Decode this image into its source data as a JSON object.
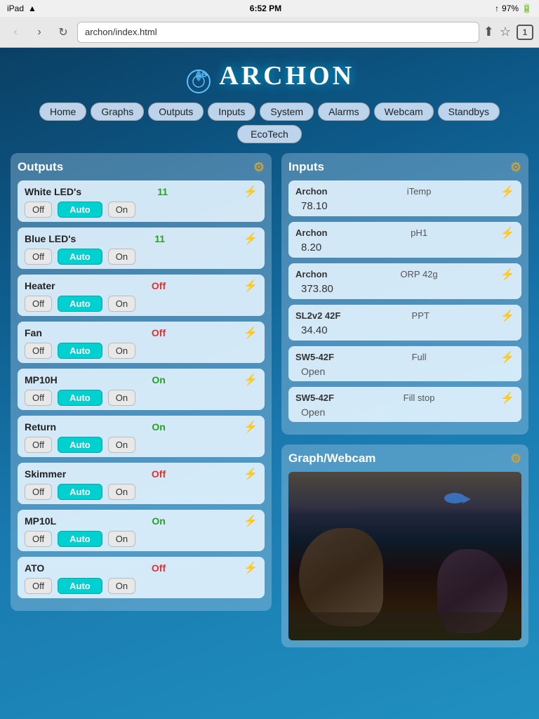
{
  "statusBar": {
    "carrier": "iPad",
    "wifi": "WiFi",
    "time": "6:52 PM",
    "battery": "97%"
  },
  "browser": {
    "url": "archon/index.html",
    "tabCount": "1"
  },
  "logo": {
    "text": "ARCHON"
  },
  "nav": {
    "items": [
      "Home",
      "Graphs",
      "Outputs",
      "Inputs",
      "System",
      "Alarms",
      "Webcam",
      "Standbys"
    ],
    "secondary": [
      "EcoTech"
    ]
  },
  "outputs": {
    "title": "Outputs",
    "devices": [
      {
        "name": "White LED's",
        "status": "11",
        "statusType": "num",
        "off": "Off",
        "auto": "Auto",
        "on": "On"
      },
      {
        "name": "Blue LED's",
        "status": "11",
        "statusType": "num",
        "off": "Off",
        "auto": "Auto",
        "on": "On"
      },
      {
        "name": "Heater",
        "status": "Off",
        "statusType": "off",
        "off": "Off",
        "auto": "Auto",
        "on": "On"
      },
      {
        "name": "Fan",
        "status": "Off",
        "statusType": "off",
        "off": "Off",
        "auto": "Auto",
        "on": "On"
      },
      {
        "name": "MP10H",
        "status": "On",
        "statusType": "on",
        "off": "Off",
        "auto": "Auto",
        "on": "On"
      },
      {
        "name": "Return",
        "status": "On",
        "statusType": "on",
        "off": "Off",
        "auto": "Auto",
        "on": "On"
      },
      {
        "name": "Skimmer",
        "status": "Off",
        "statusType": "off",
        "off": "Off",
        "auto": "Auto",
        "on": "On"
      },
      {
        "name": "MP10L",
        "status": "On",
        "statusType": "on",
        "off": "Off",
        "auto": "Auto",
        "on": "On"
      },
      {
        "name": "ATO",
        "status": "Off",
        "statusType": "off",
        "off": "Off",
        "auto": "Auto",
        "on": "On"
      }
    ]
  },
  "inputs": {
    "title": "Inputs",
    "devices": [
      {
        "source": "Archon",
        "name": "iTemp",
        "value": "78.10",
        "valueType": "num"
      },
      {
        "source": "Archon",
        "name": "pH1",
        "value": "8.20",
        "valueType": "num"
      },
      {
        "source": "Archon",
        "name": "ORP 42g",
        "value": "373.80",
        "valueType": "num"
      },
      {
        "source": "SL2v2 42F",
        "name": "PPT",
        "value": "34.40",
        "valueType": "num"
      },
      {
        "source": "SW5-42F",
        "name": "Full",
        "value": "Open",
        "valueType": "open"
      },
      {
        "source": "SW5-42F",
        "name": "Fill stop",
        "value": "Open",
        "valueType": "open"
      }
    ]
  },
  "webcam": {
    "title": "Graph/Webcam"
  },
  "icons": {
    "gear": "⚙",
    "tune": "⚡",
    "back": "‹",
    "forward": "›",
    "refresh": "↻",
    "share": "⬆",
    "bookmark": "☆",
    "wifi": "WiFi",
    "battery": "▓"
  }
}
